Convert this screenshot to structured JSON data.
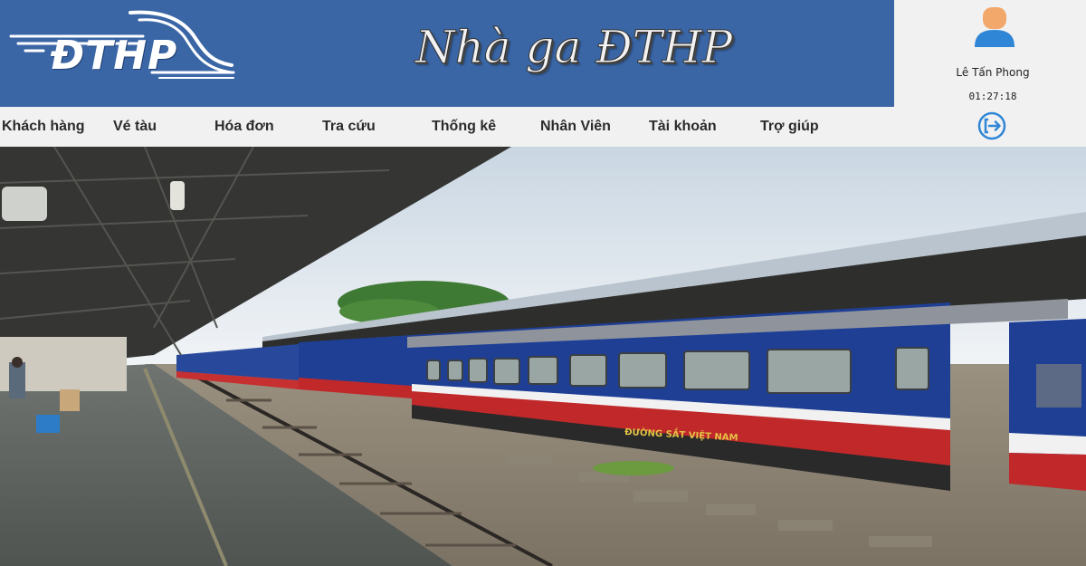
{
  "header": {
    "logo_text": "ĐTHP",
    "title": "Nhà ga ĐTHP",
    "background": "#3a66a6"
  },
  "user": {
    "name": "Lê Tấn Phong",
    "time": "01:27:18",
    "avatar_icon": "user-avatar-icon",
    "logout_icon": "logout-icon"
  },
  "nav": {
    "items": [
      {
        "label": "Khách hàng"
      },
      {
        "label": "Vé tàu"
      },
      {
        "label": "Hóa đơn"
      },
      {
        "label": "Tra cứu"
      },
      {
        "label": "Thống kê"
      },
      {
        "label": "Nhân Viên"
      },
      {
        "label": "Tài khoản"
      },
      {
        "label": "Trợ giúp"
      }
    ]
  },
  "hero": {
    "coach_label": "ĐƯỜNG SẮT VIỆT NAM"
  },
  "colors": {
    "accent": "#2f86d6",
    "nav_bg": "#f1f1f1",
    "train_blue": "#1f3f95",
    "train_red": "#c0282a"
  }
}
